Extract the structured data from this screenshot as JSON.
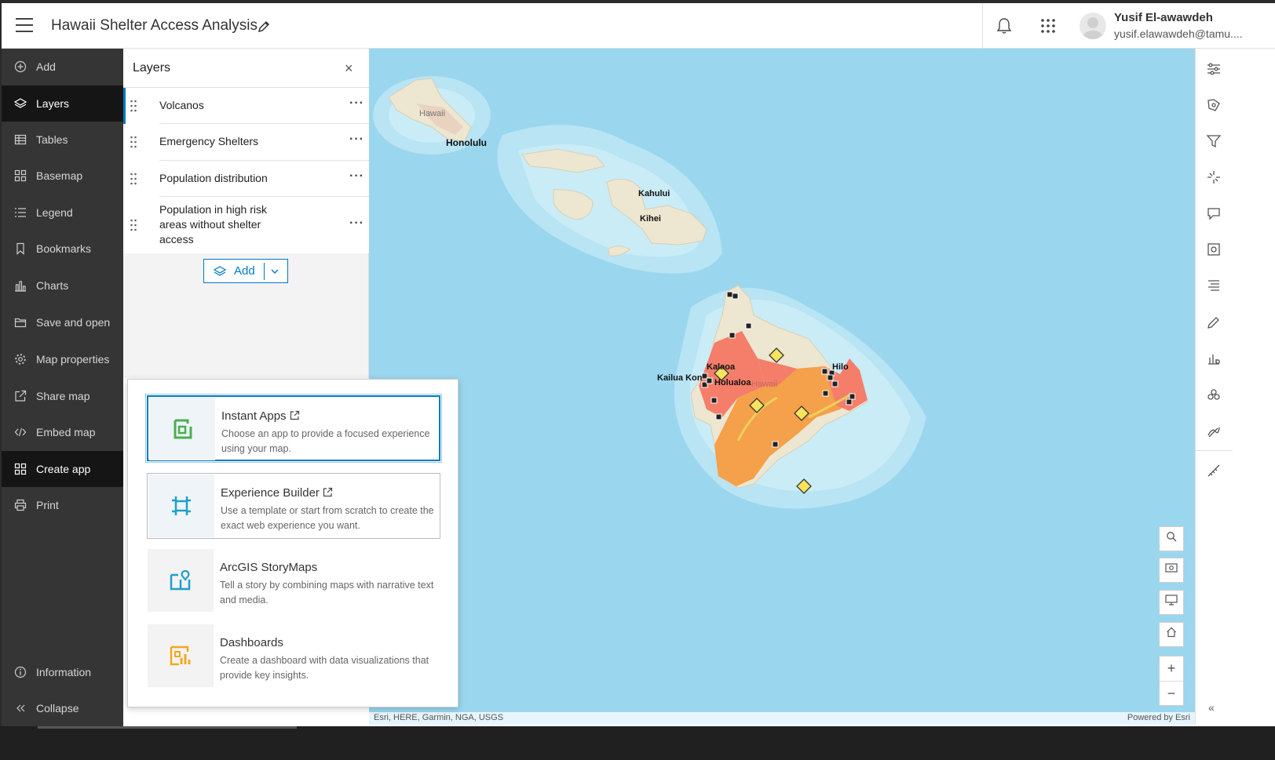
{
  "header": {
    "title": "Hawaii Shelter Access Analysis",
    "user_name": "Yusif El-awawdeh",
    "user_email": "yusif.elawawdeh@tamu...."
  },
  "sidebar": {
    "items": [
      {
        "label": "Add",
        "icon": "plus-circle-icon"
      },
      {
        "label": "Layers",
        "icon": "layers-icon",
        "active": true
      },
      {
        "label": "Tables",
        "icon": "table-icon"
      },
      {
        "label": "Basemap",
        "icon": "basemap-icon"
      },
      {
        "label": "Legend",
        "icon": "legend-icon"
      },
      {
        "label": "Bookmarks",
        "icon": "bookmark-icon"
      },
      {
        "label": "Charts",
        "icon": "chart-icon"
      },
      {
        "label": "Save and open",
        "icon": "folder-icon"
      },
      {
        "label": "Map properties",
        "icon": "gear-icon"
      },
      {
        "label": "Share map",
        "icon": "share-icon"
      },
      {
        "label": "Embed map",
        "icon": "code-icon"
      },
      {
        "label": "Create app",
        "icon": "grid-icon",
        "active": true
      },
      {
        "label": "Print",
        "icon": "print-icon"
      }
    ],
    "bottom": {
      "information": "Information",
      "collapse": "Collapse"
    }
  },
  "layers_panel": {
    "title": "Layers",
    "layers": [
      "Volcanos",
      "Emergency Shelters",
      "Population distribution",
      "Population in high risk areas without shelter access"
    ],
    "add_label": "Add"
  },
  "create_app": {
    "cards": [
      {
        "title": "Instant Apps",
        "desc": "Choose an app to provide a focused experience using your map.",
        "external": true
      },
      {
        "title": "Experience Builder",
        "desc": "Use a template or start from scratch to create the exact web experience you want.",
        "external": true
      },
      {
        "title": "ArcGIS StoryMaps",
        "desc": "Tell a story by combining maps with narrative text and media.",
        "external": false
      },
      {
        "title": "Dashboards",
        "desc": "Create a dashboard with data visualizations that provide key insights.",
        "external": false
      }
    ]
  },
  "map": {
    "labels": {
      "hawaii_oahu": "Hawaii",
      "honolulu": "Honolulu",
      "kahului": "Kahului",
      "kihei": "Kihei",
      "hilo": "Hilo",
      "kailua_kona": "Kailua Kon",
      "kalaoa": "Kalaoa",
      "holualoa": "Holualoa",
      "hawaii_big": "Hawaii"
    },
    "attribution_left": "Esri, HERE, Garmin, NGA, USGS",
    "attribution_right": "Powered by Esri",
    "colors": {
      "ocean": "#9ad7ef",
      "land": "#ede6d0",
      "risk_high": "#f47e6a",
      "risk_mid": "#f5a04a",
      "volcano": "#f7e35e"
    }
  }
}
